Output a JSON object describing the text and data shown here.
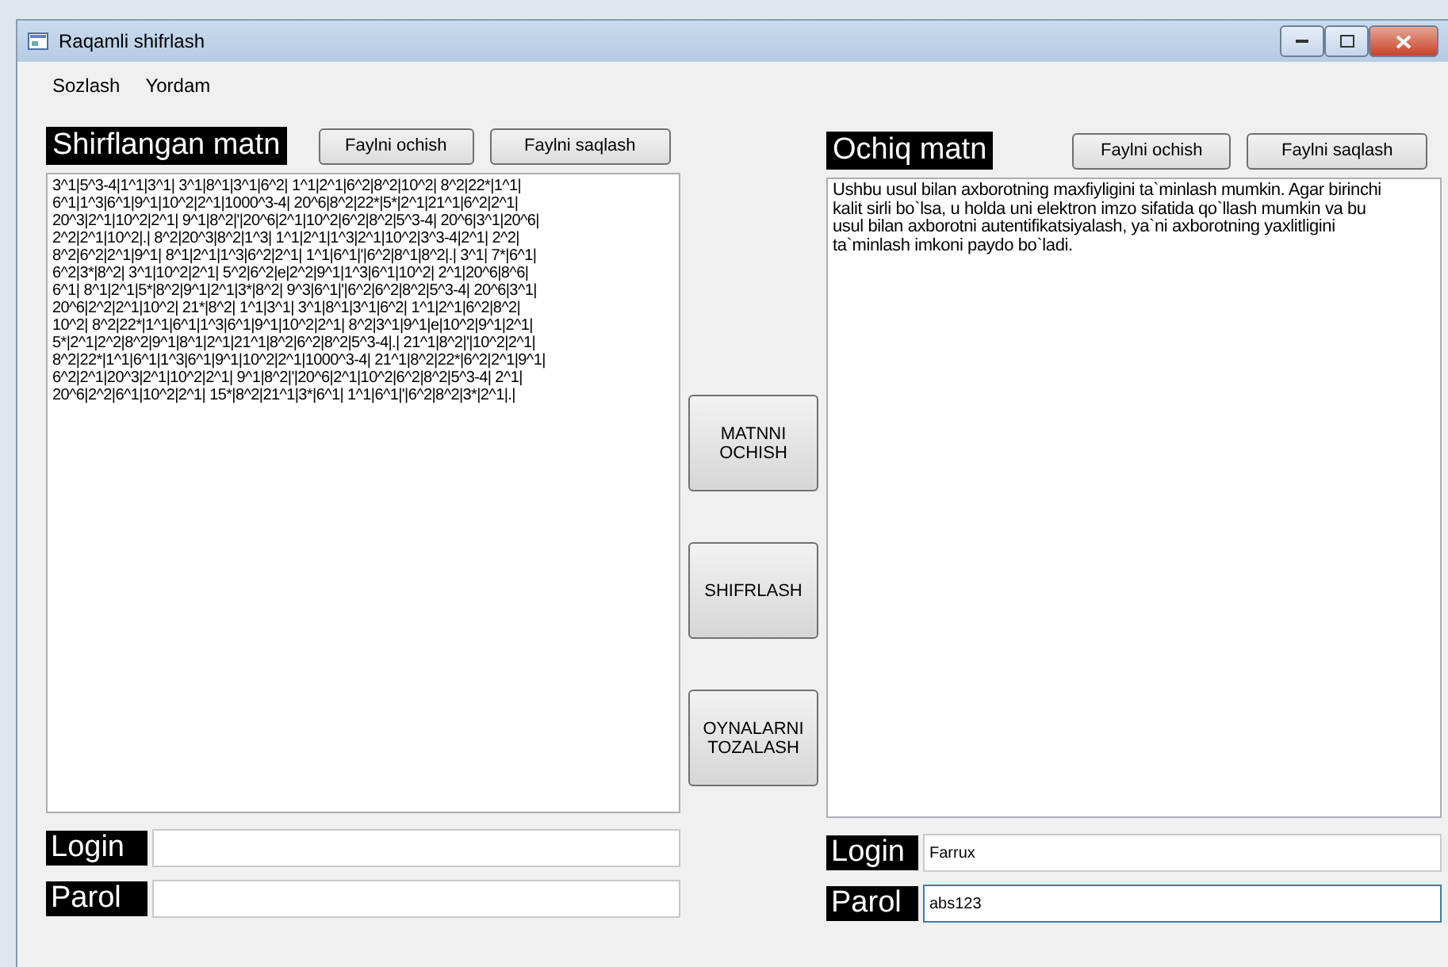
{
  "window": {
    "title": "Raqamli shifrlash"
  },
  "menu": [
    "Sozlash",
    "Yordam"
  ],
  "left_panel": {
    "heading": "Shirflangan matn",
    "buttons": [
      "Faylni ochish",
      "Faylni saqlash"
    ],
    "text_lines": [
      "3^1|5^3-4|1^1|3^1| 3^1|8^1|3^1|6^2| 1^1|2^1|6^2|8^2|10^2| 8^2|22*|1^1|",
      "6^1|1^3|6^1|9^1|10^2|2^1|1000^3-4| 20^6|8^2|22*|5*|2^1|21^1|6^2|2^1|",
      "20^3|2^1|10^2|2^1| 9^1|8^2|'|20^6|2^1|10^2|6^2|8^2|5^3-4| 20^6|3^1|20^6|",
      "2^2|2^1|10^2|.| 8^2|20^3|8^2|1^3| 1^1|2^1|1^3|2^1|10^2|3^3-4|2^1| 2^2|",
      "8^2|6^2|2^1|9^1| 8^1|2^1|1^3|6^2|2^1| 1^1|6^1|'|6^2|8^1|8^2|.| 3^1| 7*|6^1|",
      "6^2|3*|8^2| 3^1|10^2|2^1| 5^2|6^2|e|2^2|9^1|1^3|6^1|10^2| 2^1|20^6|8^6|",
      "6^1| 8^1|2^1|5*|8^2|9^1|2^1|3*|8^2| 9^3|6^1|'|6^2|6^2|8^2|5^3-4| 20^6|3^1|",
      "20^6|2^2|2^1|10^2| 21*|8^2| 1^1|3^1| 3^1|8^1|3^1|6^2| 1^1|2^1|6^2|8^2|",
      "10^2| 8^2|22*|1^1|6^1|1^3|6^1|9^1|10^2|2^1| 8^2|3^1|9^1|e|10^2|9^1|2^1|",
      "5*|2^1|2^2|8^2|9^1|8^1|2^1|21^1|8^2|6^2|8^2|5^3-4|.| 21^1|8^2|'|10^2|2^1|",
      "8^2|22*|1^1|6^1|1^3|6^1|9^1|10^2|2^1|1000^3-4| 21^1|8^2|22*|6^2|2^1|9^1|",
      "6^2|2^1|20^3|2^1|10^2|2^1| 9^1|8^2|'|20^6|2^1|10^2|6^2|8^2|5^3-4| 2^1|",
      "20^6|2^2|6^1|10^2|2^1| 15*|8^2|21^1|3*|6^1| 1^1|6^1|'|6^2|8^2|3*|2^1|.|"
    ],
    "login": {
      "label": "Login"
    },
    "password": {
      "label": "Parol"
    }
  },
  "actions": [
    "MATNNI OCHISH",
    "SHIFRLASH",
    "OYNALARNI TOZALASH"
  ],
  "right_panel": {
    "heading": "Ochiq matn",
    "buttons": [
      "Faylni ochish",
      "Faylni saqlash"
    ],
    "text": "Ushbu usul bilan axborotning maxfiyligini ta`minlash mumkin. Agar birinchi kalit sirli bo`lsa, u holda uni elektron imzo sifatida qo`llash mumkin va bu usul bilan axborotni autentifikatsiyalash, ya`ni axborotning yaxlitligini ta`minlash imkoni paydo bo`ladi.",
    "login": {
      "label": "Login",
      "value": "Farrux"
    },
    "password": {
      "label": "Parol",
      "value": "abs123",
      "focused": true
    }
  }
}
